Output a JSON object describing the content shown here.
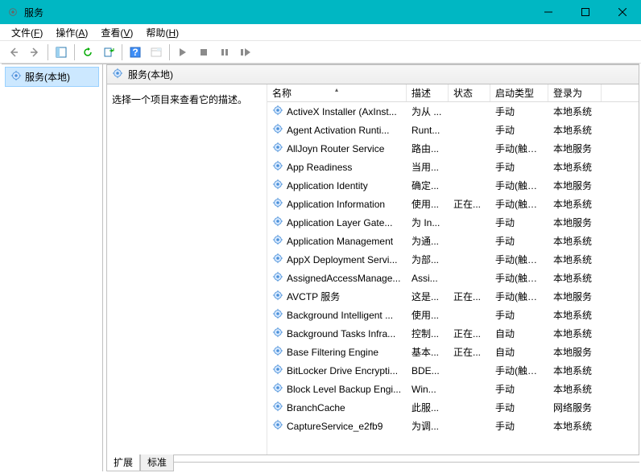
{
  "window": {
    "title": "服务"
  },
  "menu": {
    "file": {
      "label": "文件",
      "accel": "F"
    },
    "action": {
      "label": "操作",
      "accel": "A"
    },
    "view": {
      "label": "查看",
      "accel": "V"
    },
    "help": {
      "label": "帮助",
      "accel": "H"
    }
  },
  "tree": {
    "root_label": "服务(本地)"
  },
  "panel": {
    "header": "服务(本地)",
    "hint": "选择一个项目来查看它的描述。"
  },
  "columns": {
    "name": "名称",
    "description": "描述",
    "status": "状态",
    "startup_type": "启动类型",
    "log_on_as": "登录为"
  },
  "tabs": {
    "extended": "扩展",
    "standard": "标准"
  },
  "services": [
    {
      "name": "ActiveX Installer (AxInst...",
      "desc": "为从 ...",
      "state": "",
      "stype": "手动",
      "logon": "本地系统"
    },
    {
      "name": "Agent Activation Runti...",
      "desc": "Runt...",
      "state": "",
      "stype": "手动",
      "logon": "本地系统"
    },
    {
      "name": "AllJoyn Router Service",
      "desc": "路由...",
      "state": "",
      "stype": "手动(触发...",
      "logon": "本地服务"
    },
    {
      "name": "App Readiness",
      "desc": "当用...",
      "state": "",
      "stype": "手动",
      "logon": "本地系统"
    },
    {
      "name": "Application Identity",
      "desc": "确定...",
      "state": "",
      "stype": "手动(触发...",
      "logon": "本地服务"
    },
    {
      "name": "Application Information",
      "desc": "使用...",
      "state": "正在...",
      "stype": "手动(触发...",
      "logon": "本地系统"
    },
    {
      "name": "Application Layer Gate...",
      "desc": "为 In...",
      "state": "",
      "stype": "手动",
      "logon": "本地服务"
    },
    {
      "name": "Application Management",
      "desc": "为通...",
      "state": "",
      "stype": "手动",
      "logon": "本地系统"
    },
    {
      "name": "AppX Deployment Servi...",
      "desc": "为部...",
      "state": "",
      "stype": "手动(触发...",
      "logon": "本地系统"
    },
    {
      "name": "AssignedAccessManage...",
      "desc": "Assi...",
      "state": "",
      "stype": "手动(触发...",
      "logon": "本地系统"
    },
    {
      "name": "AVCTP 服务",
      "desc": "这是...",
      "state": "正在...",
      "stype": "手动(触发...",
      "logon": "本地服务"
    },
    {
      "name": "Background Intelligent ...",
      "desc": "使用...",
      "state": "",
      "stype": "手动",
      "logon": "本地系统"
    },
    {
      "name": "Background Tasks Infra...",
      "desc": "控制...",
      "state": "正在...",
      "stype": "自动",
      "logon": "本地系统"
    },
    {
      "name": "Base Filtering Engine",
      "desc": "基本...",
      "state": "正在...",
      "stype": "自动",
      "logon": "本地服务"
    },
    {
      "name": "BitLocker Drive Encrypti...",
      "desc": "BDE...",
      "state": "",
      "stype": "手动(触发...",
      "logon": "本地系统"
    },
    {
      "name": "Block Level Backup Engi...",
      "desc": "Win...",
      "state": "",
      "stype": "手动",
      "logon": "本地系统"
    },
    {
      "name": "BranchCache",
      "desc": "此服...",
      "state": "",
      "stype": "手动",
      "logon": "网络服务"
    },
    {
      "name": "CaptureService_e2fb9",
      "desc": "为调...",
      "state": "",
      "stype": "手动",
      "logon": "本地系统"
    }
  ]
}
